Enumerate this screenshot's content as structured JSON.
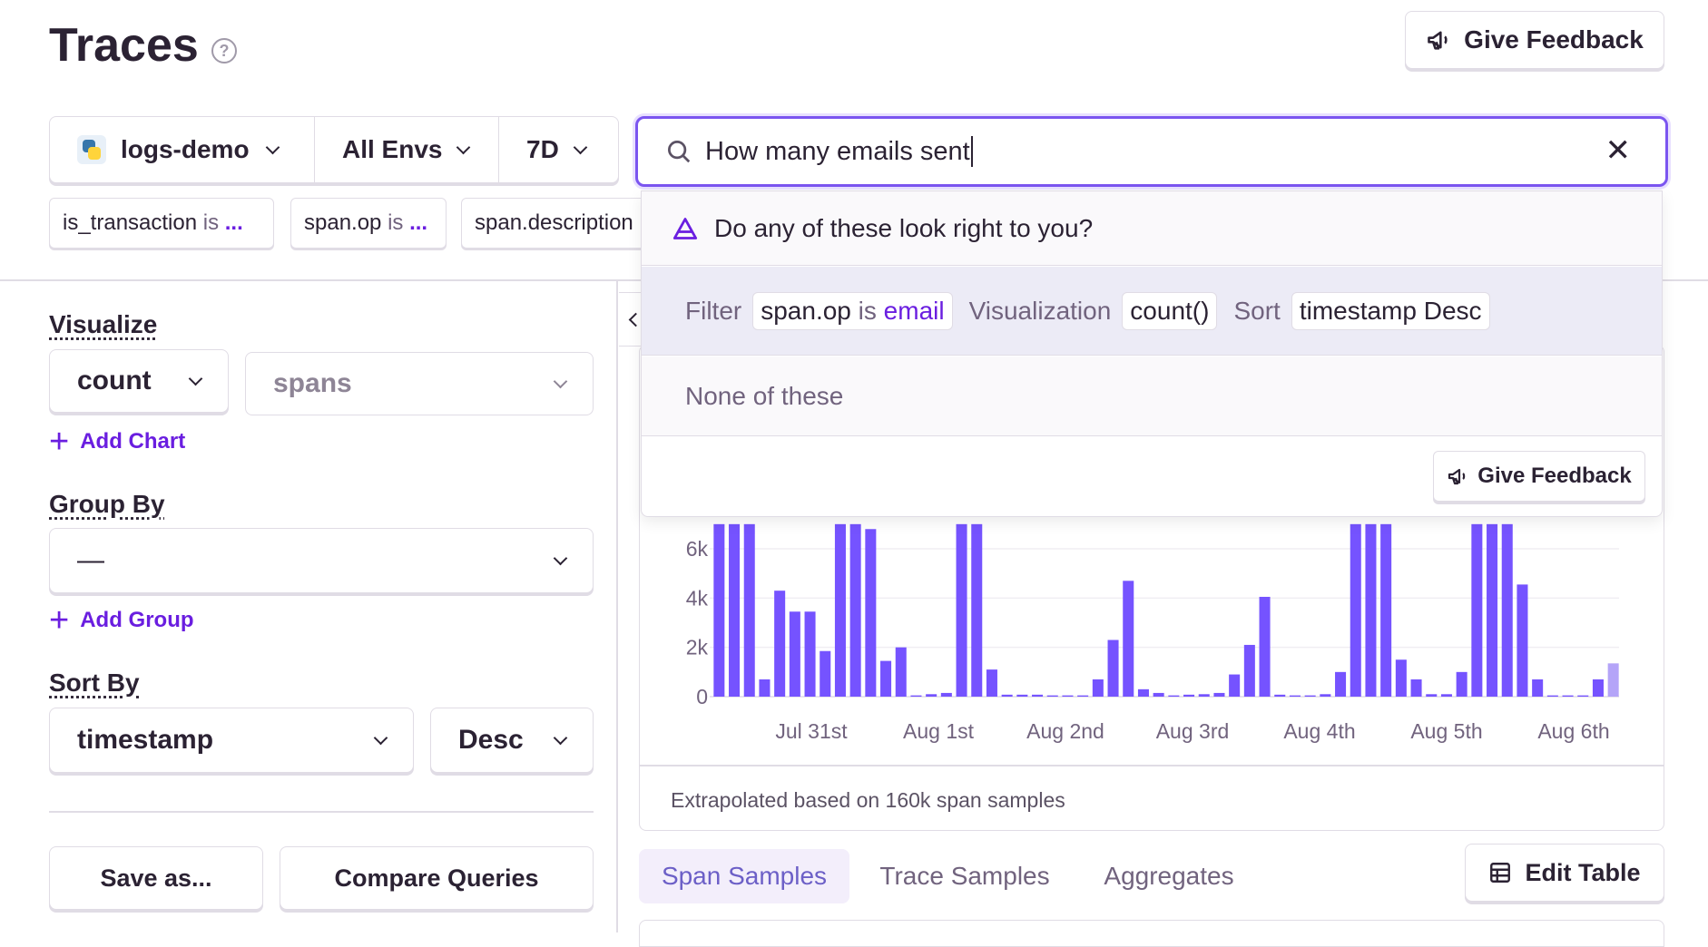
{
  "header": {
    "title": "Traces",
    "feedback_label": "Give Feedback"
  },
  "page_filters": {
    "project": "logs-demo",
    "env": "All Envs",
    "period": "7D"
  },
  "search": {
    "value": "How many emails sent"
  },
  "filter_pills": [
    {
      "key": "is_transaction",
      "op": "is",
      "val": "..."
    },
    {
      "key": "span.op",
      "op": "is",
      "val": "..."
    },
    {
      "key": "span.description",
      "op": "",
      "val": ""
    }
  ],
  "suggestions": {
    "prompt": "Do any of these look right to you?",
    "filter_label": "Filter",
    "filter_key": "span.op",
    "filter_op": "is",
    "filter_val": "email",
    "viz_label": "Visualization",
    "viz_val": "count()",
    "sort_label": "Sort",
    "sort_val": "timestamp Desc",
    "none_label": "None of these",
    "feedback_label": "Give Feedback"
  },
  "sidebar": {
    "visualize_label": "Visualize",
    "aggregate": "count",
    "field": "spans",
    "add_chart": "Add Chart",
    "groupby_label": "Group By",
    "groupby_value": "—",
    "add_group": "Add Group",
    "sortby_label": "Sort By",
    "sort_field": "timestamp",
    "sort_dir": "Desc",
    "save_as": "Save as...",
    "compare": "Compare Queries"
  },
  "chart_data": {
    "type": "bar",
    "y_ticks": [
      "0",
      "2k",
      "4k",
      "6k"
    ],
    "x_ticks": [
      "Jul 31st",
      "Aug 1st",
      "Aug 2nd",
      "Aug 3rd",
      "Aug 4th",
      "Aug 5th",
      "Aug 6th"
    ],
    "ylim": [
      0,
      7000
    ],
    "values": [
      7000,
      7000,
      7000,
      700,
      4300,
      3450,
      3450,
      1850,
      7000,
      7000,
      6800,
      1450,
      2000,
      50,
      100,
      150,
      7000,
      7000,
      1100,
      80,
      80,
      80,
      50,
      50,
      50,
      700,
      2300,
      4700,
      300,
      150,
      50,
      80,
      100,
      150,
      900,
      2100,
      4050,
      80,
      50,
      50,
      100,
      1000,
      7000,
      7000,
      7000,
      1500,
      700,
      100,
      100,
      1000,
      7000,
      7000,
      7000,
      4550,
      700,
      50,
      50,
      50,
      700,
      1350
    ],
    "footer": "Extrapolated based on 160k span samples"
  },
  "colors": {
    "bar": "#7553ff",
    "bar_last": "#b4a4f8",
    "accent": "#6c5fc7"
  },
  "tabs": {
    "span_samples": "Span Samples",
    "trace_samples": "Trace Samples",
    "aggregates": "Aggregates",
    "edit_table": "Edit Table"
  }
}
